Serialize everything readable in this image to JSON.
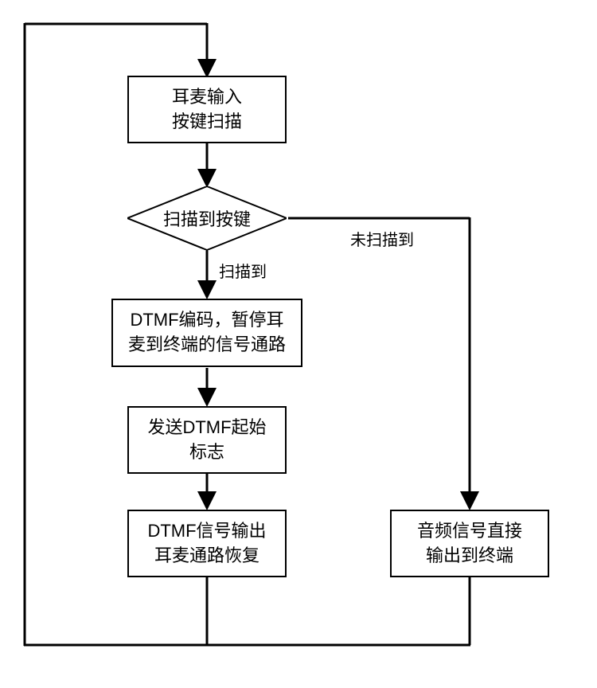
{
  "flowchart": {
    "nodes": {
      "input_scan": {
        "line1": "耳麦输入",
        "line2": "按键扫描"
      },
      "decision": "扫描到按键",
      "dtmf_encode": {
        "line1": "DTMF编码，暂停耳",
        "line2": "麦到终端的信号通路"
      },
      "send_start": {
        "line1": "发送DTMF起始",
        "line2": "标志"
      },
      "dtmf_output": {
        "line1": "DTMF信号输出",
        "line2": "耳麦通路恢复"
      },
      "audio_direct": {
        "line1": "音频信号直接",
        "line2": "输出到终端"
      }
    },
    "labels": {
      "scanned": "扫描到",
      "not_scanned": "未扫描到"
    }
  }
}
